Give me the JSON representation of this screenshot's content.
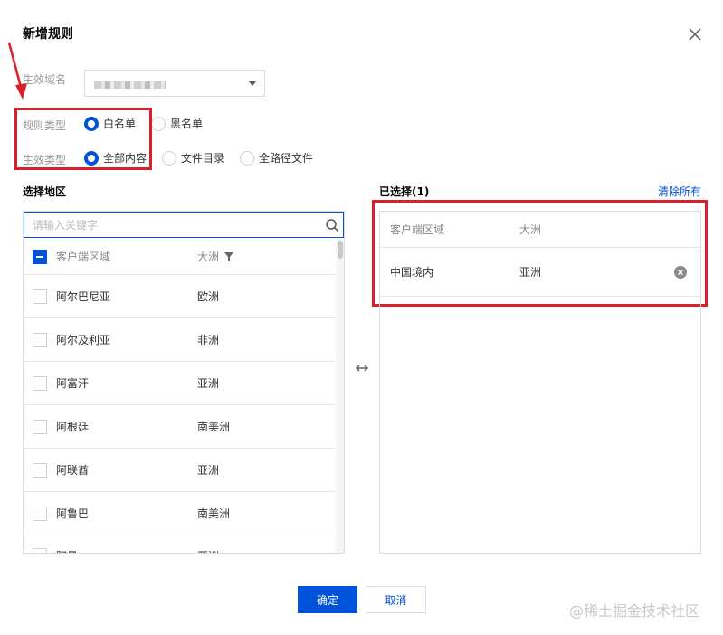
{
  "dialog": {
    "title": "新增规则",
    "close_icon": "close-icon"
  },
  "form": {
    "domain_label": "生效域名",
    "rule_type_label": "规则类型",
    "rule_type_options": [
      {
        "label": "白名单",
        "checked": true
      },
      {
        "label": "黑名单",
        "checked": false
      }
    ],
    "effect_type_label": "生效类型",
    "effect_type_options": [
      {
        "label": "全部内容",
        "checked": true
      },
      {
        "label": "文件目录",
        "checked": false
      },
      {
        "label": "全路径文件",
        "checked": false
      }
    ]
  },
  "left": {
    "title": "选择地区",
    "search_placeholder": "请输入关键字",
    "columns": {
      "region": "客户端区域",
      "continent": "大洲"
    },
    "rows": [
      {
        "region": "阿尔巴尼亚",
        "continent": "欧洲"
      },
      {
        "region": "阿尔及利亚",
        "continent": "非洲"
      },
      {
        "region": "阿富汗",
        "continent": "亚洲"
      },
      {
        "region": "阿根廷",
        "continent": "南美洲"
      },
      {
        "region": "阿联酋",
        "continent": "亚洲"
      },
      {
        "region": "阿鲁巴",
        "continent": "南美洲"
      },
      {
        "region": "阿曼",
        "continent": "亚洲"
      }
    ]
  },
  "right": {
    "title": "已选择(1)",
    "clear_all": "清除所有",
    "columns": {
      "region": "客户端区域",
      "continent": "大洲"
    },
    "rows": [
      {
        "region": "中国境内",
        "continent": "亚洲"
      }
    ]
  },
  "footer": {
    "confirm": "确定",
    "cancel": "取消"
  },
  "watermark": "@稀土掘金技术社区",
  "colors": {
    "primary": "#0052d9",
    "annotation": "#d9202d"
  }
}
